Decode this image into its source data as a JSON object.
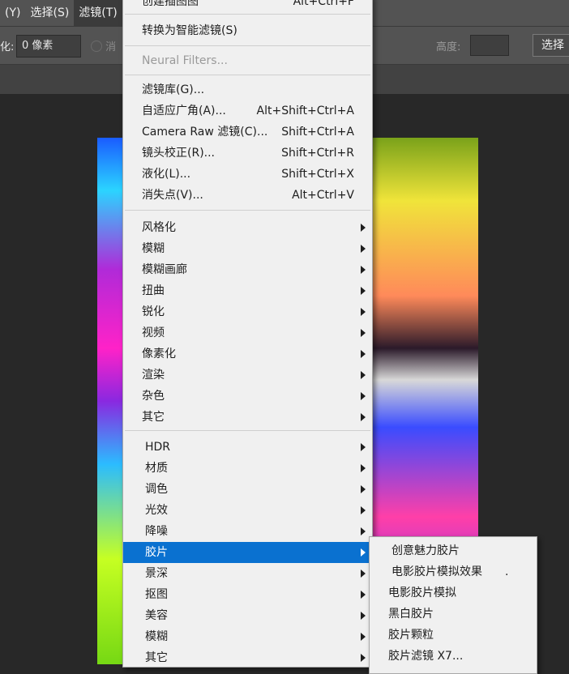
{
  "menubar": {
    "items": [
      {
        "label": "(Y)"
      },
      {
        "label": "选择(S)"
      },
      {
        "label": "滤镜(T)"
      }
    ]
  },
  "options": {
    "label_left": "化:",
    "value_left": "0 像素",
    "label_dim": "消",
    "label_height": "高度:",
    "select_btn": "选择"
  },
  "menu": {
    "top_items": [
      {
        "label": "创建插图图",
        "shortcut": "Alt+Ctrl+F"
      },
      {
        "label": "转换为智能滤镜(S)",
        "shortcut": ""
      },
      {
        "label": "Neural Filters...",
        "shortcut": "",
        "disabled": true
      }
    ],
    "group2": [
      {
        "label": "滤镜库(G)...",
        "shortcut": ""
      },
      {
        "label": "自适应广角(A)...",
        "shortcut": "Alt+Shift+Ctrl+A"
      },
      {
        "label": "Camera Raw 滤镜(C)...",
        "shortcut": "Shift+Ctrl+A"
      },
      {
        "label": "镜头校正(R)...",
        "shortcut": "Shift+Ctrl+R"
      },
      {
        "label": "液化(L)...",
        "shortcut": "Shift+Ctrl+X"
      },
      {
        "label": "消失点(V)...",
        "shortcut": "Alt+Ctrl+V"
      }
    ],
    "group3": [
      {
        "label": "风格化"
      },
      {
        "label": "模糊"
      },
      {
        "label": "模糊画廊"
      },
      {
        "label": "扭曲"
      },
      {
        "label": "锐化"
      },
      {
        "label": "视频"
      },
      {
        "label": "像素化"
      },
      {
        "label": "渲染"
      },
      {
        "label": "杂色"
      },
      {
        "label": "其它"
      }
    ],
    "group4": [
      {
        "label": "HDR"
      },
      {
        "label": "材质"
      },
      {
        "label": "调色"
      },
      {
        "label": "光效"
      },
      {
        "label": "降噪"
      },
      {
        "label": "胶片",
        "highlighted": true
      },
      {
        "label": "景深"
      },
      {
        "label": "抠图"
      },
      {
        "label": "美容"
      },
      {
        "label": "模糊"
      },
      {
        "label": "其它"
      }
    ]
  },
  "submenu": {
    "items": [
      {
        "label": "创意魅力胶片"
      },
      {
        "label": "电影胶片模拟效果　　."
      },
      {
        "label": "电影胶片模拟"
      },
      {
        "label": "黑白胶片"
      },
      {
        "label": "胶片颗粒"
      },
      {
        "label": "胶片滤镜 X7..."
      }
    ]
  }
}
